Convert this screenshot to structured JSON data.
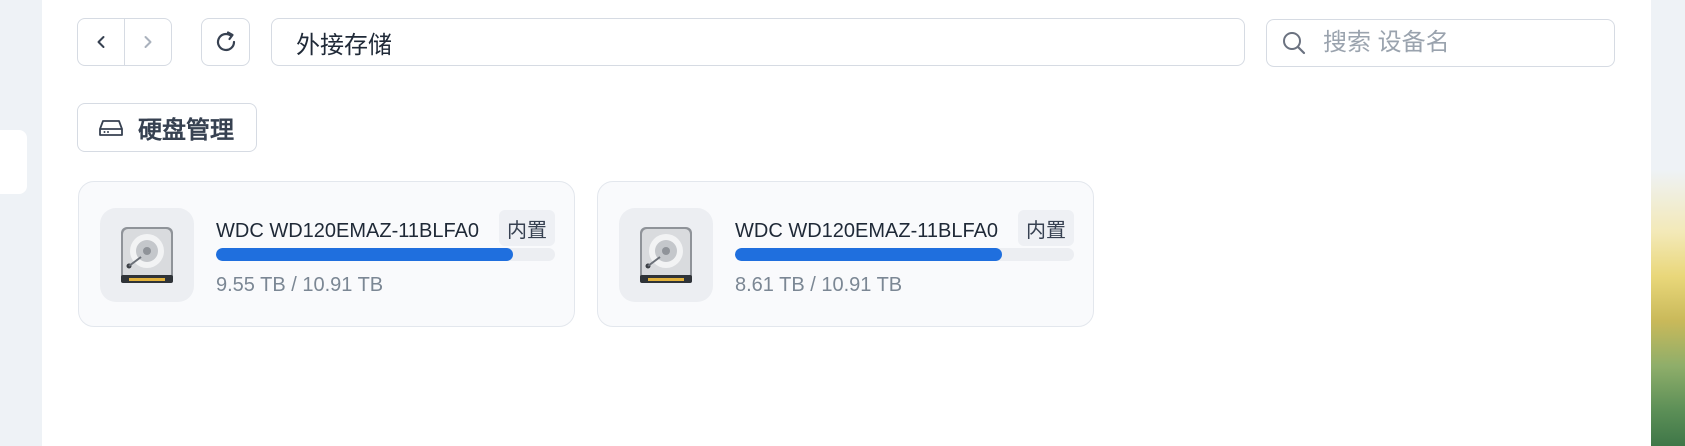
{
  "toolbar": {
    "back_icon": "chevron-left-icon",
    "forward_icon": "chevron-right-icon",
    "refresh_icon": "refresh-icon",
    "path": "外接存储",
    "search_placeholder": "搜索 设备名",
    "search_icon": "search-icon"
  },
  "disk_management": {
    "label": "硬盘管理",
    "icon": "hard-drive-icon"
  },
  "disks": [
    {
      "name": "WDC WD120EMAZ-11BLFA0",
      "tag": "内置",
      "usage": "9.55 TB / 10.91 TB",
      "used_fraction": 0.875
    },
    {
      "name": "WDC WD120EMAZ-11BLFA0",
      "tag": "内置",
      "usage": "8.61 TB / 10.91 TB",
      "used_fraction": 0.789
    }
  ],
  "colors": {
    "accent": "#1f6fde",
    "track": "#eceef2",
    "border": "#d6dbe3"
  }
}
